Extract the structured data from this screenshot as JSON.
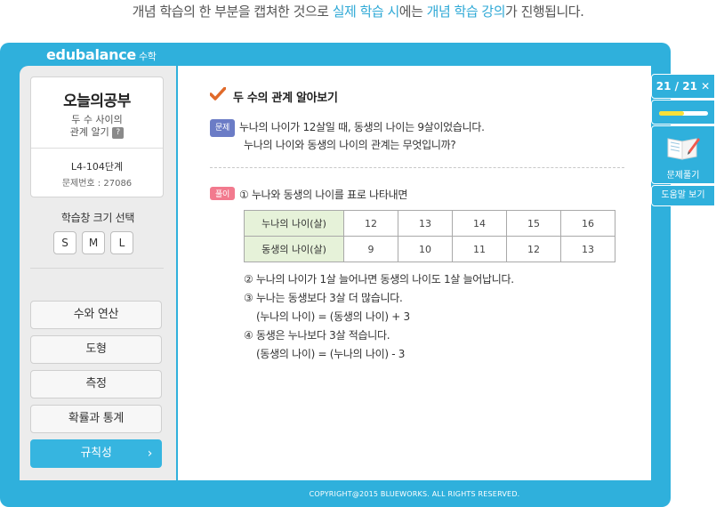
{
  "caption": {
    "part1": "개념 학습의 한 부분을 캡쳐한 것으로 ",
    "hl1": "실제 학습 시",
    "part2": "에는 ",
    "hl2": "개념 학습 강의",
    "part3": "가 진행됩니다."
  },
  "brand": {
    "name": "edubalance",
    "sub": "수학"
  },
  "today": {
    "title": "오늘의공부",
    "sub_line1": "두 수 사이의",
    "sub_line2": "관계 알기",
    "help_badge": "?",
    "unit_code": "L4-104단계",
    "problem_number": "문제번호 : 27086"
  },
  "size_select": {
    "label": "학습창 크기 선택",
    "options": [
      "S",
      "M",
      "L"
    ]
  },
  "menu": [
    {
      "label": "수와 연산",
      "active": false
    },
    {
      "label": "도형",
      "active": false
    },
    {
      "label": "측정",
      "active": false
    },
    {
      "label": "확률과 통계",
      "active": false
    },
    {
      "label": "규칙성",
      "active": true,
      "arrow": "›"
    }
  ],
  "content": {
    "heading": "두 수의 관계 알아보기",
    "problem_tag": "문제",
    "problem_line1": "누나의 나이가 12살일 때, 동생의 나이는 9살이었습니다.",
    "problem_line2": "누나의 나이와 동생의 나이의 관계는 무엇입니까?",
    "solution_tag": "풀이",
    "solution_intro": "① 누나와 동생의 나이를 표로 나타내면",
    "table": {
      "rows": [
        {
          "header": "누나의 나이(살)",
          "values": [
            "12",
            "13",
            "14",
            "15",
            "16"
          ]
        },
        {
          "header": "동생의 나이(살)",
          "values": [
            "9",
            "10",
            "11",
            "12",
            "13"
          ]
        }
      ]
    },
    "step2": "② 누나의 나이가 1살 늘어나면 동생의 나이도 1살 늘어납니다.",
    "step3": "③ 누나는 동생보다 3살 더 많습니다.",
    "step3_formula": "(누나의 나이) = (동생의 나이) + 3",
    "step4": "④ 동생은 누나보다 3살 적습니다.",
    "step4_formula": "(동생의 나이) = (누나의 나이) - 3"
  },
  "footer": {
    "copyright": "COPYRIGHT@2015 BLUEWORKS. ALL RIGHTS RESERVED."
  },
  "right_panel": {
    "counter": "21 / 21",
    "close_glyph": "✕",
    "progress_fraction": 0.5,
    "solve_label": "문제풀기",
    "help_label": "도움말 보기"
  },
  "colors": {
    "frame": "#2fb0dc",
    "highlight": "#2fa9d6",
    "active_menu": "#36b5e0",
    "progress": "#f7e03a",
    "problem_tag": "#6b7cc6",
    "solution_tag": "#f27a8e",
    "table_header": "#e6f2d9"
  }
}
